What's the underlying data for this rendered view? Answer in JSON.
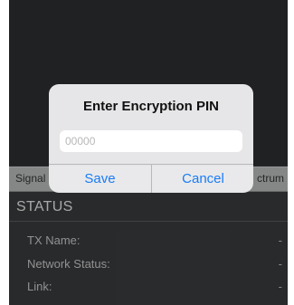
{
  "tabs": {
    "signal": "Signal",
    "spectrum": "ctrum"
  },
  "status": {
    "title": "STATUS",
    "rows": [
      {
        "label": "TX Name:",
        "value": "-"
      },
      {
        "label": "Network Status:",
        "value": "-"
      },
      {
        "label": "Link:",
        "value": "-"
      }
    ]
  },
  "dialog": {
    "title": "Enter Encryption PIN",
    "pin_placeholder": "00000",
    "save_label": "Save",
    "cancel_label": "Cancel"
  },
  "colors": {
    "accent": "#1a7cf5",
    "background": "#3a3b3d"
  }
}
